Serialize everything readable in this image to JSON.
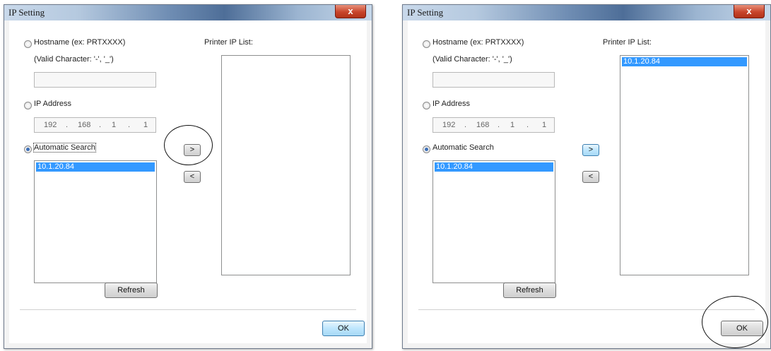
{
  "left_dialog": {
    "title": "IP Setting",
    "close_glyph": "x",
    "hostname_label": "Hostname (ex: PRTXXXX)",
    "valid_char_label": "(Valid Character: '-', '_')",
    "hostname_value": "",
    "ip_address_label": "IP Address",
    "ip_octets": [
      "192",
      "168",
      "1",
      "1"
    ],
    "ip_dot": ".",
    "auto_search_label": "Automatic Search",
    "search_results": [
      "10.1.20.84"
    ],
    "add_button": ">",
    "remove_button": "<",
    "refresh_button": "Refresh",
    "printer_list_label": "Printer IP List:",
    "printer_list": [],
    "ok_button": "OK",
    "selected_radio": "automatic_search"
  },
  "right_dialog": {
    "title": "IP Setting",
    "close_glyph": "x",
    "hostname_label": "Hostname (ex: PRTXXXX)",
    "valid_char_label": "(Valid Character: '-', '_')",
    "hostname_value": "",
    "ip_address_label": "IP Address",
    "ip_octets": [
      "192",
      "168",
      "1",
      "1"
    ],
    "ip_dot": ".",
    "auto_search_label": "Automatic Search",
    "search_results": [
      "10.1.20.84"
    ],
    "add_button": ">",
    "remove_button": "<",
    "refresh_button": "Refresh",
    "printer_list_label": "Printer IP List:",
    "printer_list": [
      "10.1.20.84"
    ],
    "ok_button": "OK",
    "selected_radio": "automatic_search"
  },
  "colors": {
    "selection": "#3399ff",
    "close_button": "#c8452c",
    "hot_button": "#bee6fd"
  }
}
